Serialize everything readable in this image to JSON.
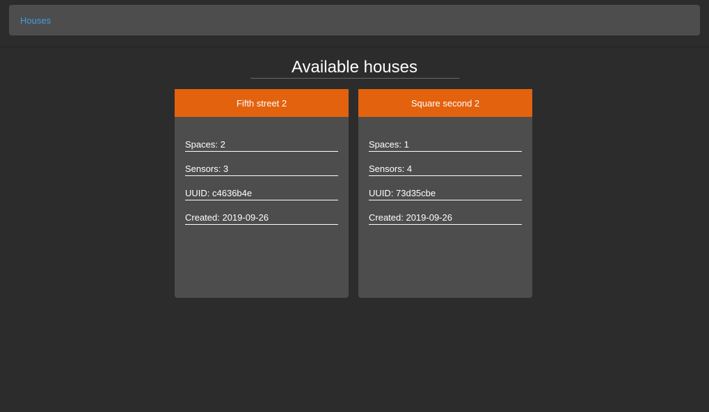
{
  "breadcrumb": {
    "houses_label": "Houses"
  },
  "page": {
    "title": "Available houses"
  },
  "colors": {
    "accent": "#e3620e",
    "link": "#3f9fe3",
    "card_bg": "#4d4d4d",
    "page_bg": "#2c2c2c"
  },
  "houses": [
    {
      "name": "Fifth street 2",
      "spaces": "Spaces: 2",
      "sensors": "Sensors: 3",
      "uuid": "UUID: c4636b4e",
      "created": "Created: 2019-09-26"
    },
    {
      "name": "Square second 2",
      "spaces": "Spaces: 1",
      "sensors": "Sensors: 4",
      "uuid": "UUID: 73d35cbe",
      "created": "Created: 2019-09-26"
    }
  ]
}
